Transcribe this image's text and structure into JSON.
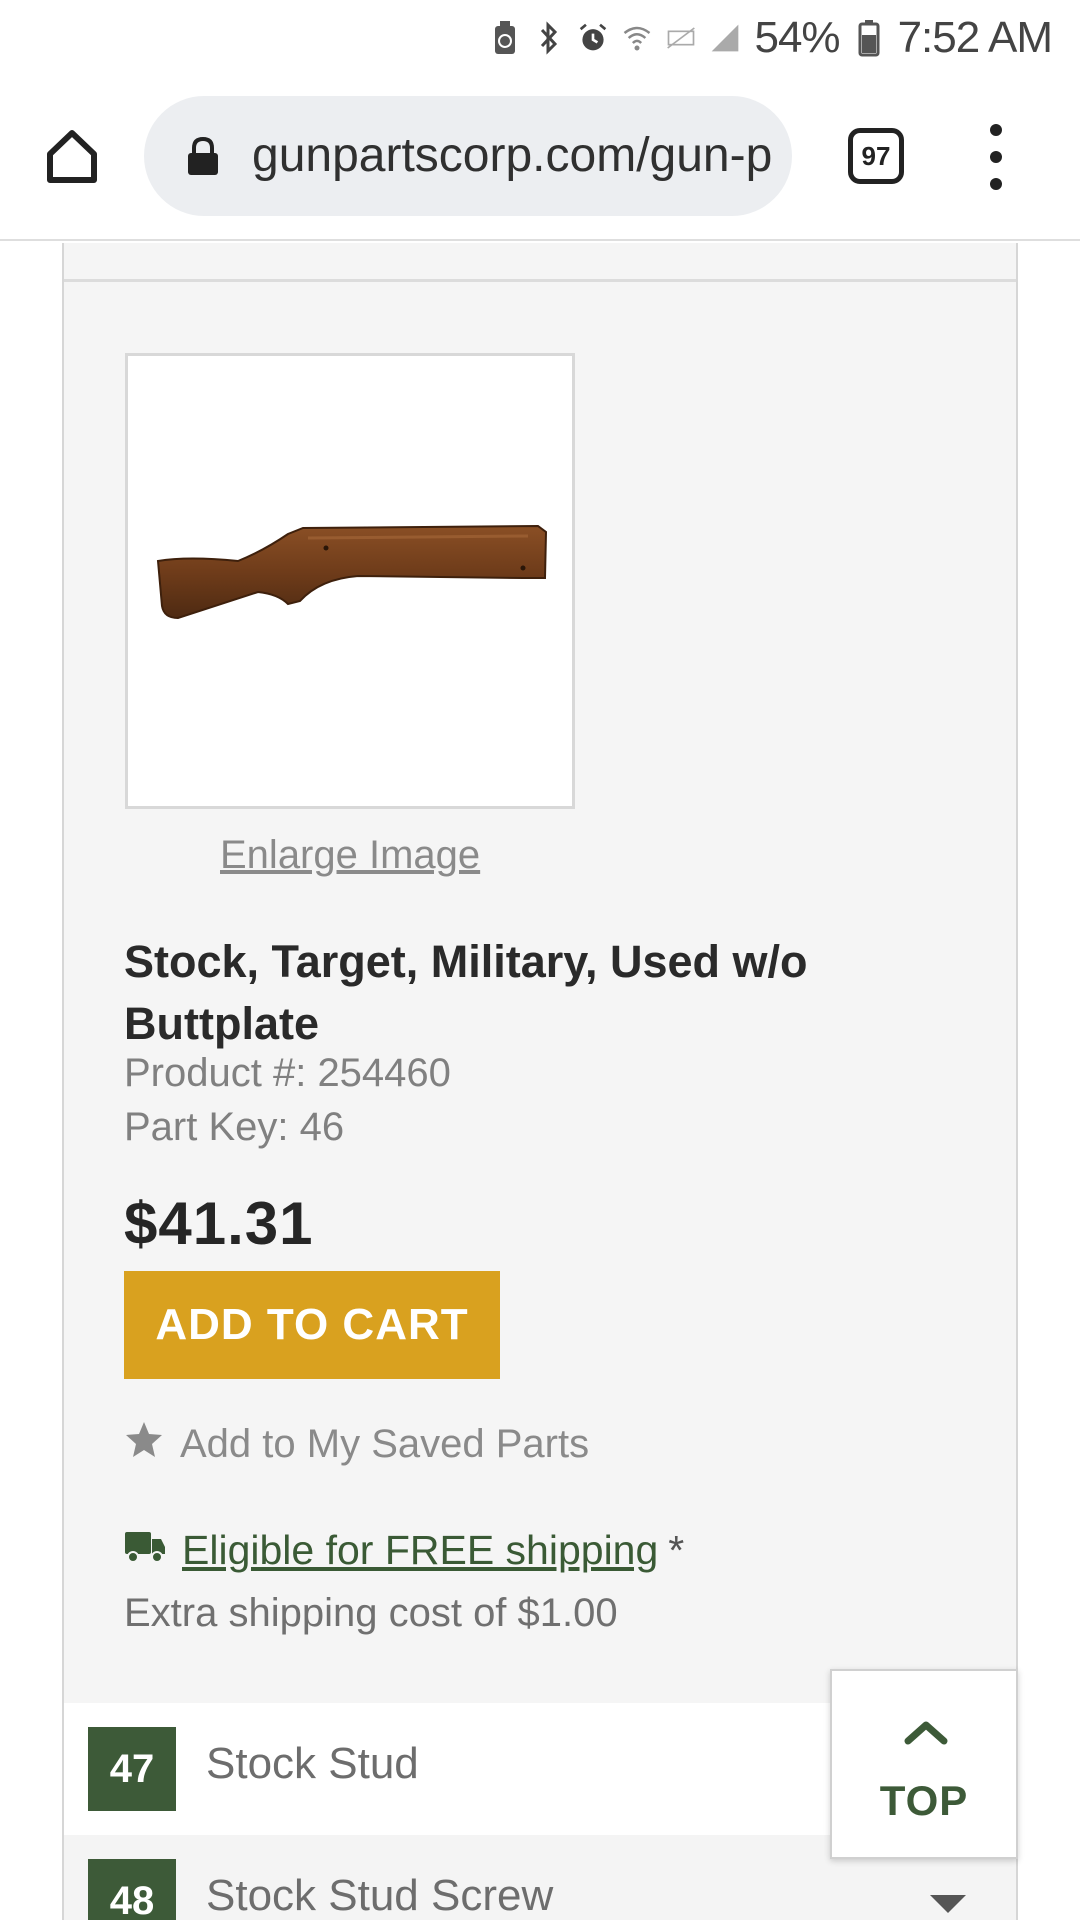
{
  "status_bar": {
    "battery_percent": "54%",
    "time": "7:52 AM",
    "icons": [
      "recycle-battery-icon",
      "bluetooth-icon",
      "alarm-icon",
      "wifi-icon",
      "data-off-icon",
      "signal-icon",
      "battery-icon"
    ]
  },
  "browser": {
    "url": "gunpartscorp.com/gun-parts",
    "tab_count": "97",
    "icons": [
      "home-icon",
      "lock-icon",
      "tabs-icon",
      "more-vertical-icon"
    ]
  },
  "product": {
    "enlarge_label": "Enlarge Image",
    "title": "Stock, Target, Military, Used w/o Buttplate",
    "product_number": "Product #: 254460",
    "part_key": "Part Key: 46",
    "price": "$41.31",
    "add_to_cart_label": "ADD TO CART",
    "saved_parts_label": "Add to My Saved Parts",
    "free_shipping_label": "Eligible for FREE shipping",
    "free_shipping_asterisk": "*",
    "extra_shipping": "Extra shipping cost of $1.00"
  },
  "parts_list": [
    {
      "key": "47",
      "label": "Stock Stud"
    },
    {
      "key": "48",
      "label": "Stock Stud Screw"
    }
  ],
  "top_button": {
    "label": "TOP"
  },
  "colors": {
    "accent_green": "#3d5a38",
    "cart_gold": "#d9a11f",
    "panel_bg": "#f5f5f5"
  }
}
